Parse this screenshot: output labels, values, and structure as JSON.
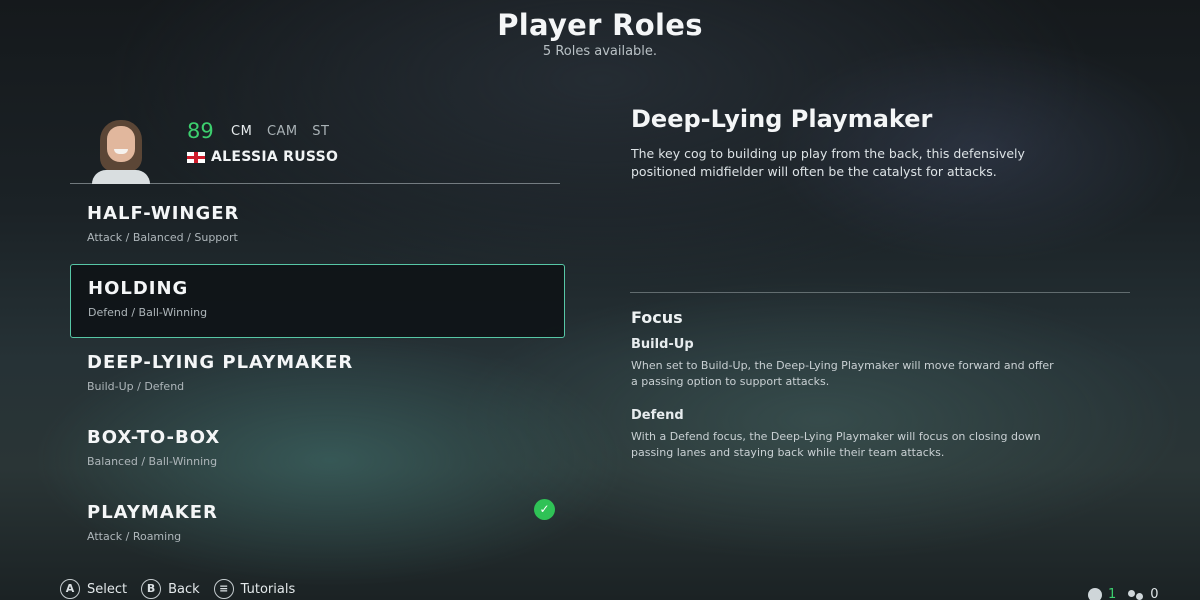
{
  "header": {
    "title": "Player Roles",
    "subtitle": "5 Roles available."
  },
  "player": {
    "rating": "89",
    "positions": [
      "CM",
      "CAM",
      "ST"
    ],
    "name": "ALESSIA RUSSO",
    "nationality_flag": "england-flag"
  },
  "roles": [
    {
      "name": "HALF-WINGER",
      "tags": "Attack / Balanced / Support"
    },
    {
      "name": "HOLDING",
      "tags": "Defend / Ball-Winning",
      "selected": true
    },
    {
      "name": "DEEP-LYING PLAYMAKER",
      "tags": "Build-Up / Defend"
    },
    {
      "name": "BOX-TO-BOX",
      "tags": "Balanced / Ball-Winning"
    },
    {
      "name": "PLAYMAKER",
      "tags": "Attack / Roaming",
      "checked": true
    }
  ],
  "detail": {
    "title": "Deep-Lying Playmaker",
    "description": "The key cog to building up play from the back, this defensively positioned midfielder will often be the catalyst for attacks.",
    "focus_heading": "Focus",
    "focus_items": [
      {
        "label": "Build-Up",
        "text": "When set to Build-Up, the Deep-Lying Playmaker will move forward and offer a passing option to support attacks."
      },
      {
        "label": "Defend",
        "text": "With a Defend focus, the Deep-Lying Playmaker will focus on closing down passing lanes and staying back while their team attacks."
      }
    ]
  },
  "footer": {
    "hints": [
      {
        "glyph": "A",
        "label": "Select"
      },
      {
        "glyph": "B",
        "label": "Back"
      },
      {
        "glyph": "≡",
        "label": "Tutorials"
      }
    ]
  },
  "status": {
    "count_a": "1",
    "count_b": "0"
  },
  "colors": {
    "rating_green": "#3ccf6e",
    "selected_border": "#57c7a6",
    "check_green": "#2fc256"
  }
}
